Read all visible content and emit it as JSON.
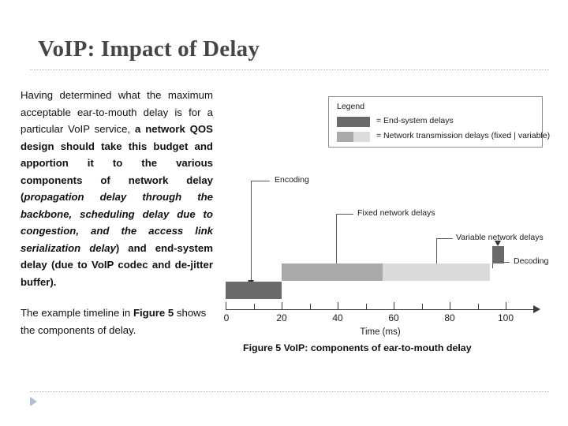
{
  "slide": {
    "title": "VoIP: Impact of Delay"
  },
  "body": {
    "paragraph1": {
      "seg1": "Having determined what the maximum acceptable ear-to-mouth delay is for a particular VoIP service, ",
      "seg2_bold": "a network QOS design should take this budget and apportion it to the various components of network delay (",
      "seg3_bold_italic": "propagation delay through the backbone, scheduling delay due to congestion, and the access link serialization delay",
      "seg4_bold": ") and end-system delay (due to VoIP codec and de-jitter buffer)."
    },
    "paragraph2": {
      "seg1": "The example timeline in ",
      "seg2_bold": "Figure 5",
      "seg3": " shows the components of delay."
    }
  },
  "figure": {
    "caption": "Figure 5 VoIP: components of ear-to-mouth delay",
    "legend": {
      "title": "Legend",
      "entries": [
        {
          "label": "= End-system delays",
          "swatch": "dark",
          "color": "#6a6a6a"
        },
        {
          "label": "= Network transmission delays (fixed | variable)",
          "swatch": "split",
          "color_fixed": "#a9a9a9",
          "color_variable": "#dcdcdc"
        }
      ]
    }
  },
  "chart_data": {
    "type": "bar",
    "title": "Figure 5 VoIP: components of ear-to-mouth delay",
    "xlabel": "Time (ms)",
    "ylabel": "",
    "xlim": [
      0,
      110
    ],
    "grid": false,
    "orientation": "horizontal-timeline",
    "legend_position": "top-right",
    "tick_labels": [
      "0",
      "20",
      "40",
      "60",
      "80",
      "100"
    ],
    "tick_values": [
      0,
      20,
      40,
      60,
      80,
      100
    ],
    "minor_tick_values": [
      10,
      30,
      50,
      70,
      90,
      110
    ],
    "categories": [
      "Encoding",
      "Fixed network delays",
      "Variable network delays",
      "Decoding"
    ],
    "series": [
      {
        "name": "Encoding",
        "label": "Encoding",
        "start": 0,
        "end": 20,
        "duration": 20,
        "color": "#6a6a6a",
        "class": "End-system delays",
        "row": 0
      },
      {
        "name": "Fixed network delays",
        "label": "Fixed network delays",
        "start": 20,
        "end": 56,
        "duration": 36,
        "color": "#a9a9a9",
        "class": "Network transmission delays (fixed)",
        "row": 1
      },
      {
        "name": "Variable network delays",
        "label": "Variable network delays",
        "start": 56,
        "end": 94,
        "duration": 38,
        "color": "#d9d9d9",
        "class": "Network transmission delays (variable)",
        "row": 1
      },
      {
        "name": "Decoding",
        "label": "Decoding",
        "start": 95,
        "end": 99,
        "duration": 4,
        "color": "#6a6a6a",
        "class": "End-system delays",
        "row": 2
      }
    ],
    "annotations": [
      {
        "text": "Encoding",
        "points_to": 10
      },
      {
        "text": "Fixed network delays",
        "points_to": 40
      },
      {
        "text": "Variable network delays",
        "points_to": 76
      },
      {
        "text": "Decoding",
        "points_to": 97
      }
    ]
  }
}
